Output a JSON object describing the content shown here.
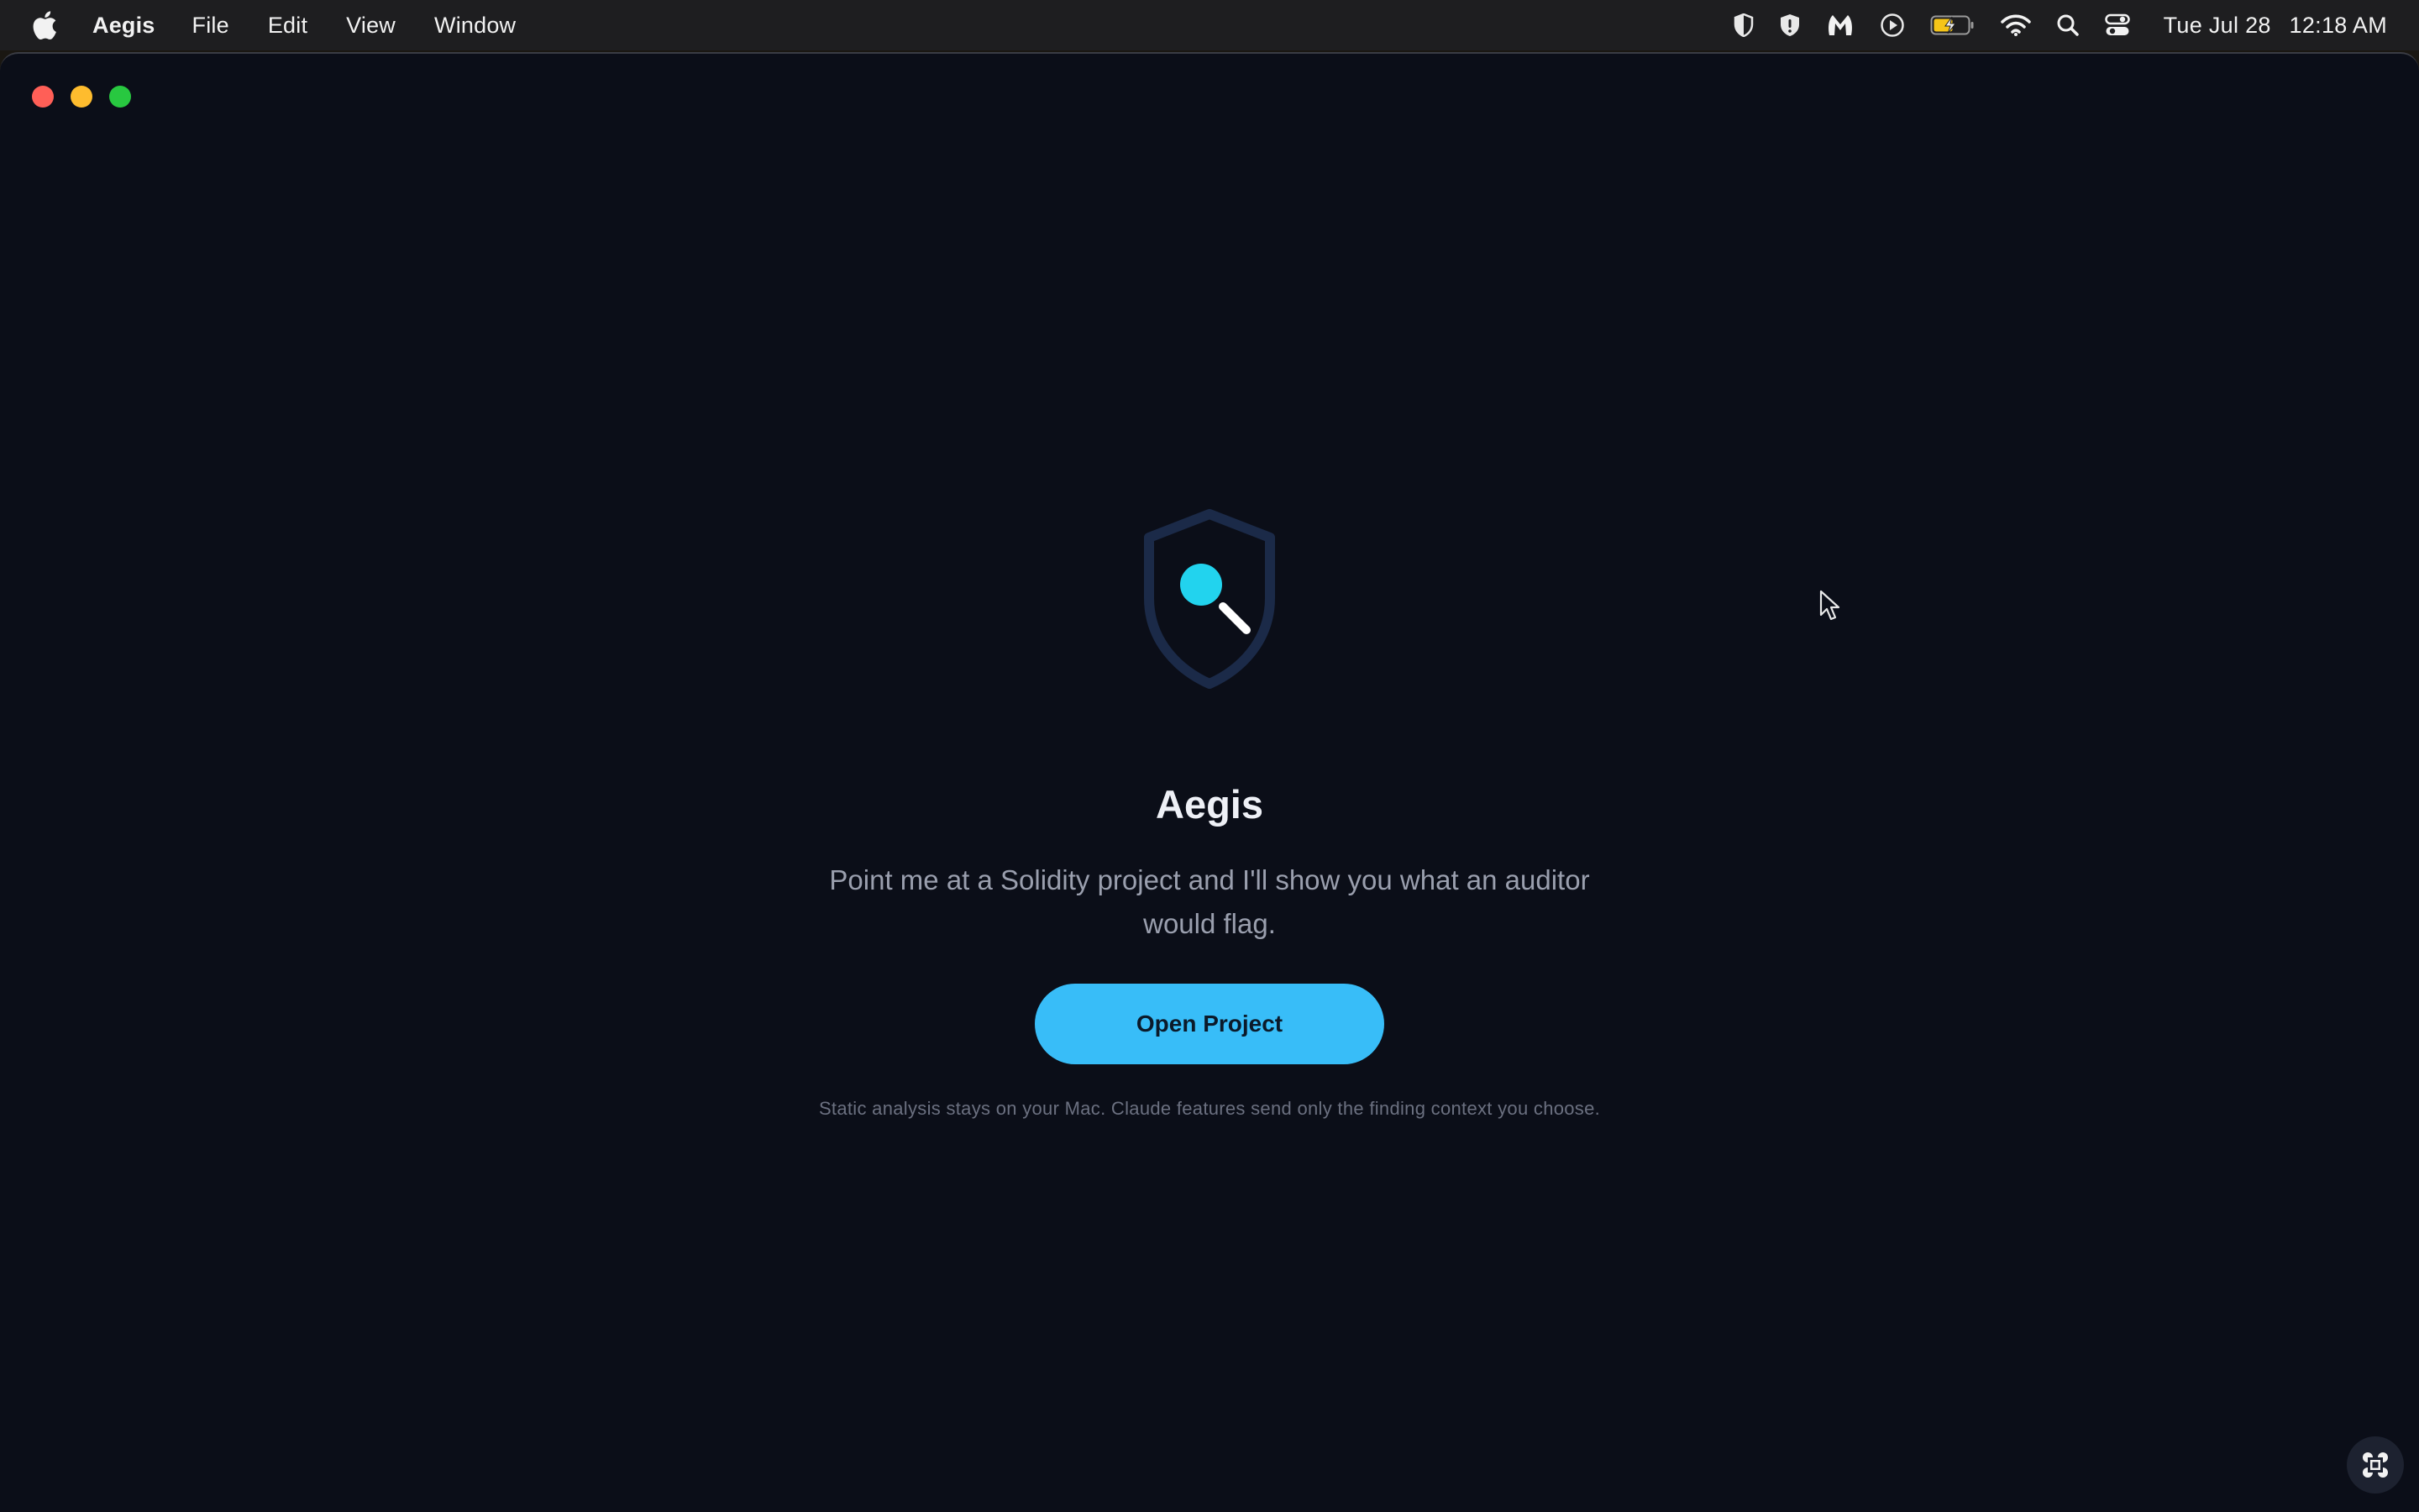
{
  "menubar": {
    "app_name": "Aegis",
    "items": [
      "File",
      "Edit",
      "View",
      "Window"
    ],
    "status_icons": [
      "shield-half-icon",
      "shield-alert-icon",
      "malwarebytes-icon",
      "play-circle-icon",
      "battery-charging-icon",
      "wifi-icon",
      "spotlight-search-icon",
      "control-center-icon"
    ],
    "clock": {
      "date": "Tue Jul 28",
      "time": "12:18 AM"
    }
  },
  "window": {
    "traffic_lights": [
      "close",
      "minimize",
      "maximize"
    ]
  },
  "main": {
    "title": "Aegis",
    "tagline": "Point me at a Solidity project and I'll show you what an auditor would flag.",
    "open_button_label": "Open Project",
    "privacy_note": "Static analysis stays on your Mac. Claude features send only the finding context you choose."
  },
  "colors": {
    "window_bg": "#0b0e18",
    "accent": "#38bdf8",
    "shield": "#1b2a48",
    "lens": "#22d3ee"
  }
}
